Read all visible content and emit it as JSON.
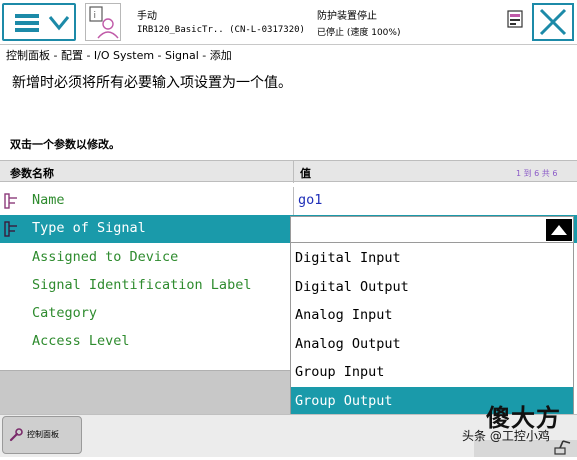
{
  "header": {
    "status_mode": "手动",
    "robot_info": "IRB120_BasicTr.. (CN-L-0317320)",
    "guard_status": "防护装置停止",
    "run_state": "已停止 (速度 100%)"
  },
  "breadcrumb": "控制面板 - 配置 - I/O System - Signal - 添加",
  "instruction": "新增时必须将所有必要输入项设置为一个值。",
  "hint": "双击一个参数以修改。",
  "table": {
    "col_param": "参数名称",
    "col_value": "值",
    "page_count": "1 到 6 共 6",
    "rows": [
      {
        "label": "Name",
        "value": "go1"
      },
      {
        "label": "Type of Signal"
      },
      {
        "label": "Assigned to Device"
      },
      {
        "label": "Signal Identification Label"
      },
      {
        "label": "Category"
      },
      {
        "label": "Access Level"
      }
    ]
  },
  "dropdown": {
    "selected": "Group Output",
    "options": [
      "Digital Input",
      "Digital Output",
      "Analog Input",
      "Analog Output",
      "Group Input",
      "Group Output"
    ]
  },
  "taskbar": {
    "panel_button": "控制面板"
  },
  "watermark": {
    "big": "傻大方",
    "small": "头条 @工控小鸡"
  },
  "colors": {
    "accent": "#1a9aaa",
    "param_text": "#2e8b2e",
    "value_text": "#1f2fb8"
  }
}
